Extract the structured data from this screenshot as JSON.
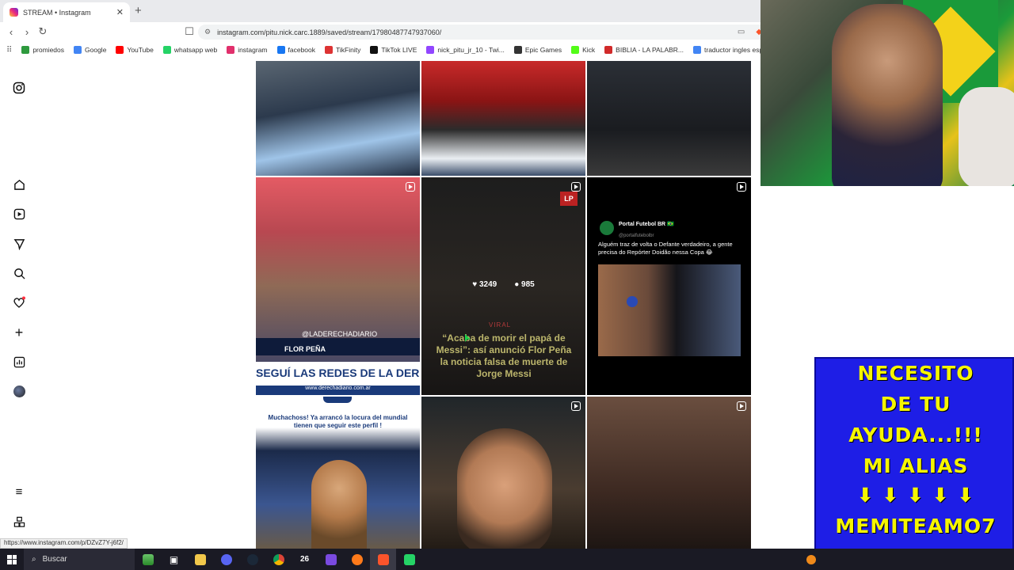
{
  "browser": {
    "tab_title": "STREAM • Instagram",
    "url": "instagram.com/pitu.nick.carc.1889/saved/stream/17980487747937060/",
    "bookmarks": [
      {
        "label": "promiedos",
        "icon_color": "#2e9a3e"
      },
      {
        "label": "Google",
        "icon_color": "#4285f4"
      },
      {
        "label": "YouTube",
        "icon_color": "#ff0000"
      },
      {
        "label": "whatsapp web",
        "icon_color": "#25d366"
      },
      {
        "label": "instagram",
        "icon_color": "#e1306c"
      },
      {
        "label": "facebook",
        "icon_color": "#1877f2"
      },
      {
        "label": "TikFinity",
        "icon_color": "#d33"
      },
      {
        "label": "TikTok LIVE",
        "icon_color": "#111111"
      },
      {
        "label": "nick_pitu_jr_10 - Twi...",
        "icon_color": "#9146ff"
      },
      {
        "label": "Epic Games",
        "icon_color": "#333333"
      },
      {
        "label": "Kick",
        "icon_color": "#53fc18"
      },
      {
        "label": "BIBLIA - LA PALABR...",
        "icon_color": "#d12a2a"
      },
      {
        "label": "traductor ingles esp...",
        "icon_color": "#4285f4"
      }
    ]
  },
  "posts": {
    "flor": {
      "handle": "@LADERECHADIARIO",
      "name": "FLOR PEÑA",
      "banner": "SEGUÍ LAS REDES DE LA DERECHA",
      "site": "www.derechadiario.com.ar"
    },
    "viral": {
      "likes": "3249",
      "comments": "985",
      "label": "VIRAL",
      "title": "“Acaba de morir el papá de Messi”: así anunció Flor Peña la noticia falsa de muerte de Jorge Messi",
      "logo": "LP"
    },
    "tweet": {
      "name": "Portal Futebol BR 🇧🇷",
      "handle": "@portalfutebolbr",
      "text": "Alguém traz de volta o Defante verdadeiro, a gente precisa do Repórter Doidão nessa Copa 😂"
    },
    "mundial": {
      "text": "Muchachoss! Ya arrancó la locura del mundial tienen que seguir este perfil !"
    }
  },
  "donation": {
    "lines": [
      "NECESITO",
      "DE TU",
      "AYUDA...!!!",
      "MI ALIAS",
      "⬇ ⬇ ⬇ ⬇ ⬇",
      "MEMITEAMO7"
    ]
  },
  "status_url": "https://www.instagram.com/p/DZvZ7Y-j6f2/",
  "taskbar": {
    "search_label": "Buscar",
    "temp": "26"
  },
  "colors": {
    "donation_bg": "#1e1ee6",
    "donation_text": "#f5f500"
  }
}
